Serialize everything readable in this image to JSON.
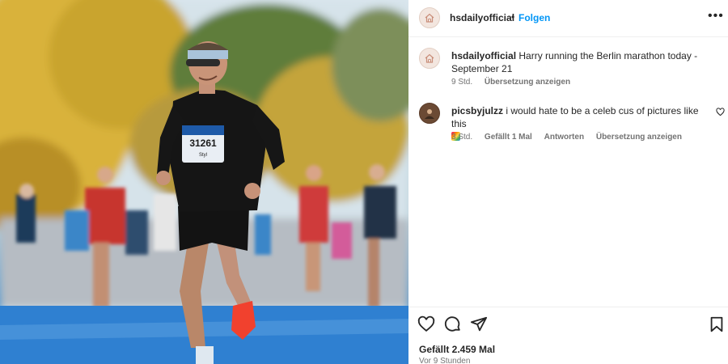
{
  "header": {
    "username": "hsdailyofficial",
    "separator": "•",
    "follow_label": "Folgen",
    "more_icon": "more-horizontal-icon"
  },
  "caption": {
    "username": "hsdailyofficial",
    "text": "Harry running the Berlin marathon today - September 21",
    "time": "9 Std.",
    "translate_label": "Übersetzung anzeigen"
  },
  "comment": {
    "username": "picsbyjulzz",
    "text": "i would hate to be a celeb cus of pictures like this",
    "time": "3 Std.",
    "likes_label": "Gefällt 1 Mal",
    "reply_label": "Antworten",
    "translate_label": "Übersetzung anzeigen"
  },
  "photo": {
    "bib_number": "31261",
    "bib_name": "Styl"
  },
  "footer": {
    "likes_text": "Gefällt 2.459 Mal",
    "time_ago": "Vor 9 Stunden"
  },
  "colors": {
    "accent": "#0095f6",
    "text": "#262626",
    "secondary": "#737373"
  }
}
